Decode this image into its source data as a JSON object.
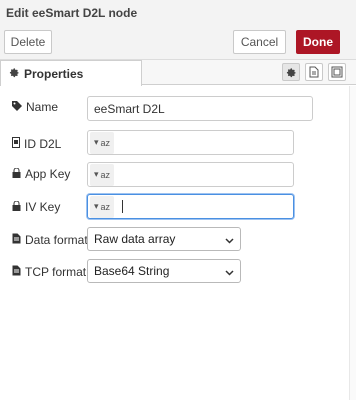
{
  "header": {
    "title": "Edit eeSmart D2L node"
  },
  "actions": {
    "delete": "Delete",
    "cancel": "Cancel",
    "done": "Done"
  },
  "tabs": {
    "properties": "Properties"
  },
  "form": {
    "name": {
      "label": "Name",
      "value": "eeSmart D2L"
    },
    "id_d2l": {
      "label": "ID D2L",
      "type_glyph": "az",
      "value": ""
    },
    "app_key": {
      "label": "App Key",
      "type_glyph": "az",
      "value": ""
    },
    "iv_key": {
      "label": "IV Key",
      "type_glyph": "az",
      "value": ""
    },
    "data_format": {
      "label": "Data format",
      "value": "Raw data array"
    },
    "tcp_format": {
      "label": "TCP format",
      "value": "Base64 String"
    }
  },
  "colors": {
    "primary": "#ad1625",
    "focus": "#4a90e2"
  }
}
